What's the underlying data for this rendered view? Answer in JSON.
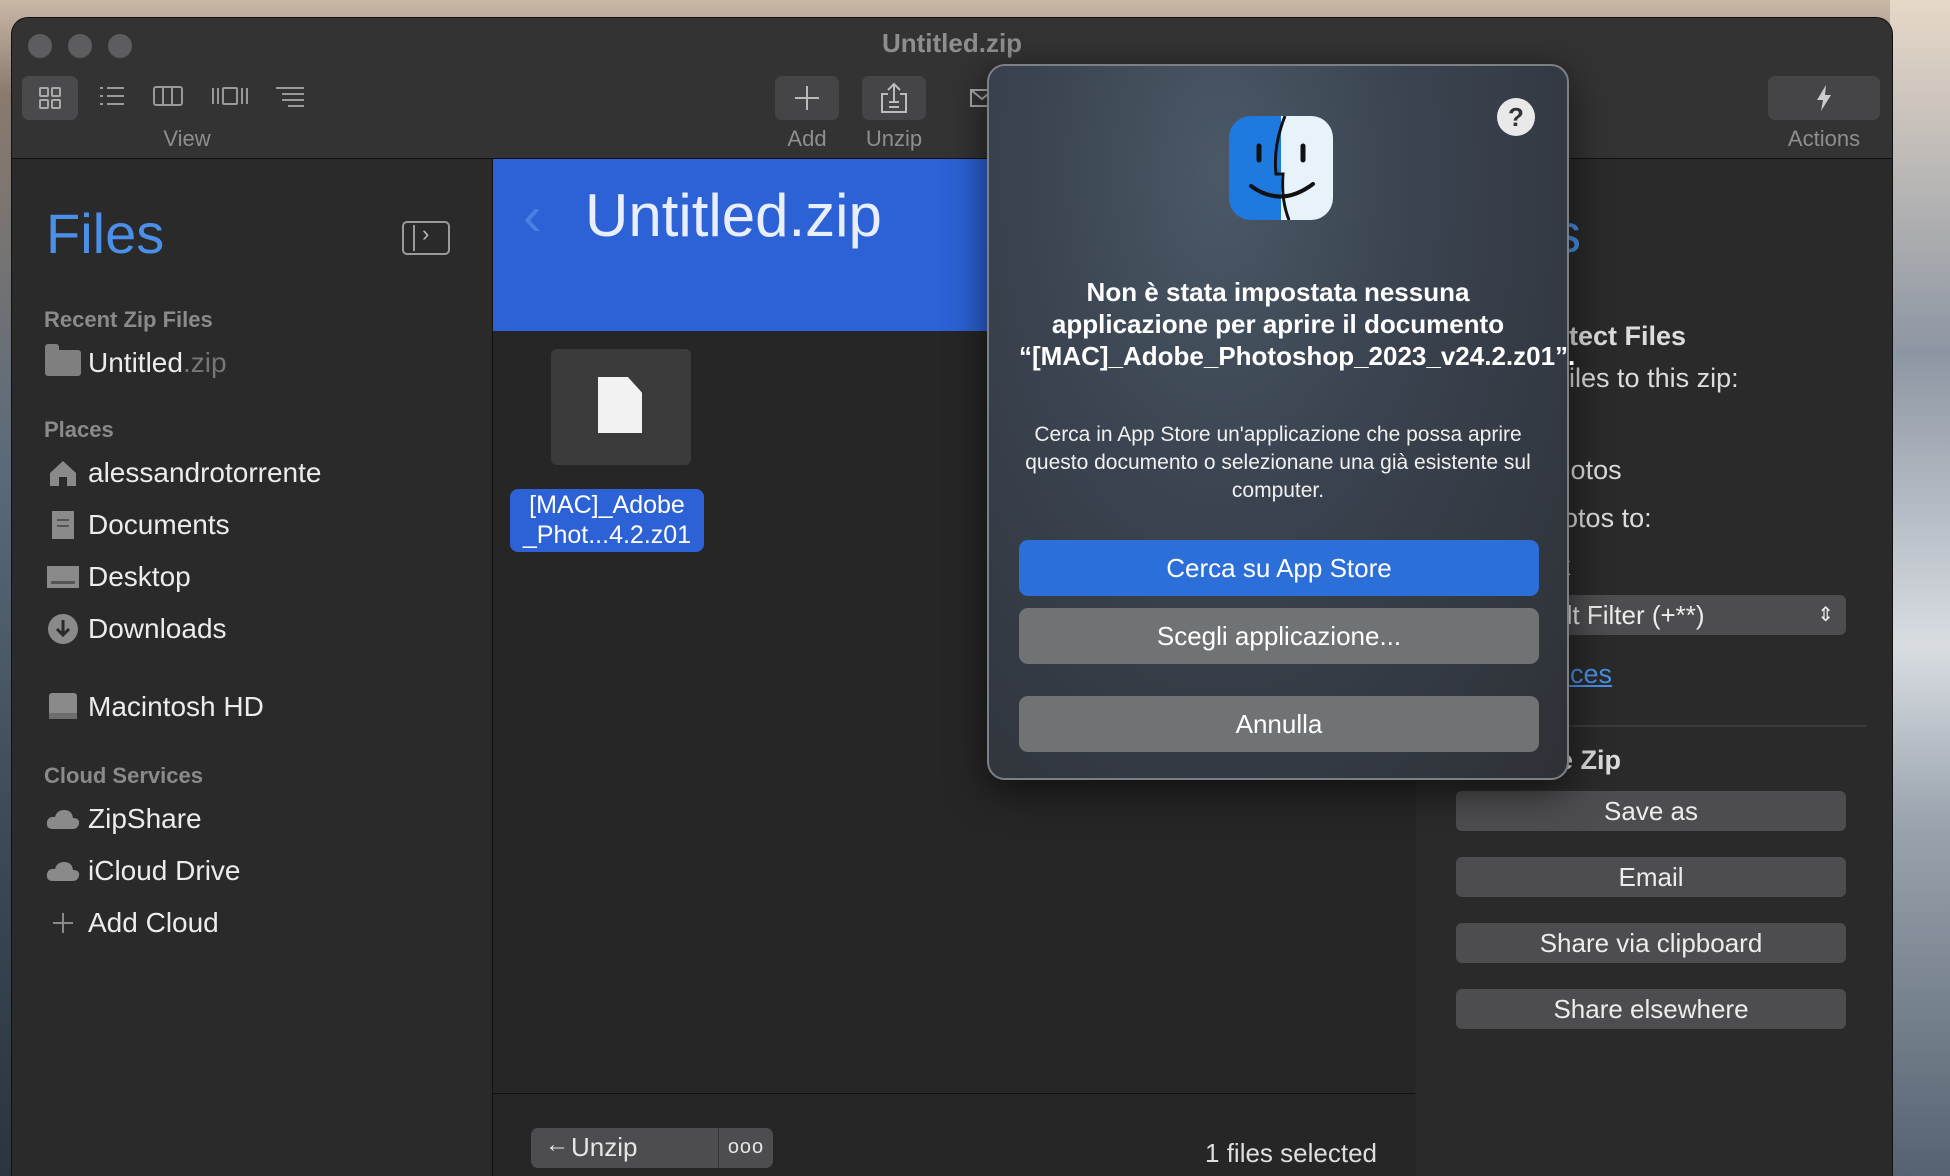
{
  "window": {
    "title": "Untitled.zip"
  },
  "toolbar": {
    "view_label": "View",
    "add_label": "Add",
    "unzip_label": "Unzip",
    "actions_label": "Actions"
  },
  "sidebar": {
    "title": "Files",
    "recent_heading": "Recent Zip Files",
    "recent_items": [
      {
        "name": "Untitled",
        "ext": ".zip"
      }
    ],
    "places_heading": "Places",
    "places": [
      {
        "label": "alessandrotorrente",
        "icon": "home-icon"
      },
      {
        "label": "Documents",
        "icon": "documents-folder-icon"
      },
      {
        "label": "Desktop",
        "icon": "desktop-folder-icon"
      },
      {
        "label": "Downloads",
        "icon": "downloads-icon"
      }
    ],
    "drive": {
      "label": "Macintosh HD",
      "icon": "hard-drive-icon"
    },
    "cloud_heading": "Cloud Services",
    "cloud": [
      {
        "label": "ZipShare",
        "icon": "cloud-icon"
      },
      {
        "label": "iCloud Drive",
        "icon": "cloud-icon"
      },
      {
        "label": "Add Cloud",
        "icon": "plus-icon"
      }
    ]
  },
  "main": {
    "title": "Untitled.zip",
    "file": {
      "label_line1": "[MAC]_Adobe",
      "label_line2": "_Phot...4.2.z01"
    },
    "footer": {
      "unzip_button": "Unzip",
      "selection_status": "1 files selected"
    }
  },
  "right_panel": {
    "heading_fragment": "ns",
    "protect_heading": "Protect Files",
    "adding_text": "ing files to this zip:",
    "partial_t": "t",
    "photos_text": "e photos",
    "convert_text": "t photos to:",
    "watermark_text": "nark",
    "filter_select": "efault Filter (+**)",
    "preferences_link": "erences",
    "share_heading": "hare Zip",
    "buttons": [
      "Save as",
      "Email",
      "Share via clipboard",
      "Share elsewhere"
    ]
  },
  "dialog": {
    "title": "Non è stata impostata nessuna applicazione per aprire il documento “[MAC]_Adobe_Photoshop_2023_v24.2.z01”.",
    "message": "Cerca in App Store un'applicazione che possa aprire questo documento o selezionane una già esistente sul computer.",
    "primary_button": "Cerca su App Store",
    "choose_button": "Scegli applicazione...",
    "cancel_button": "Annulla",
    "help": "?"
  },
  "colors": {
    "accent": "#2c62d6",
    "link": "#4a8fe8",
    "window_bg": "#262626"
  }
}
